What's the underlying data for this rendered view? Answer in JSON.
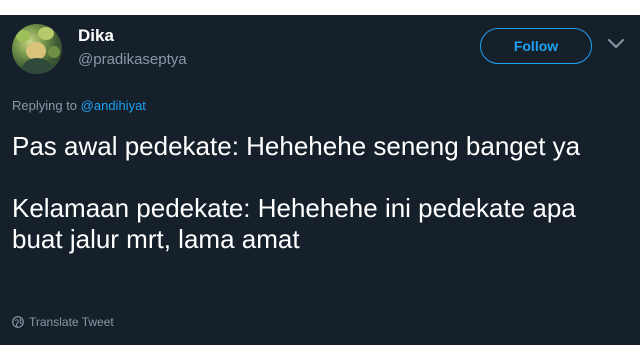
{
  "tweet": {
    "user": {
      "display_name": "Dika",
      "handle": "@pradikaseptya",
      "avatar_icon": "avatar-photo"
    },
    "follow_label": "Follow",
    "menu_icon": "chevron-down-icon",
    "replying_prefix": "Replying to",
    "replying_mention": "@andihiyat",
    "text_paragraphs": [
      "Pas awal pedekate: Hehehehe seneng banget ya",
      "Kelamaan pedekate: Hehehehe ini pedekate apa buat jalur mrt, lama amat"
    ],
    "translate_label": "Translate Tweet",
    "translate_icon": "globe-icon"
  },
  "colors": {
    "background": "#15202b",
    "accent": "#1da1f2",
    "secondary_text": "#8899a6",
    "primary_text": "#ffffff"
  }
}
